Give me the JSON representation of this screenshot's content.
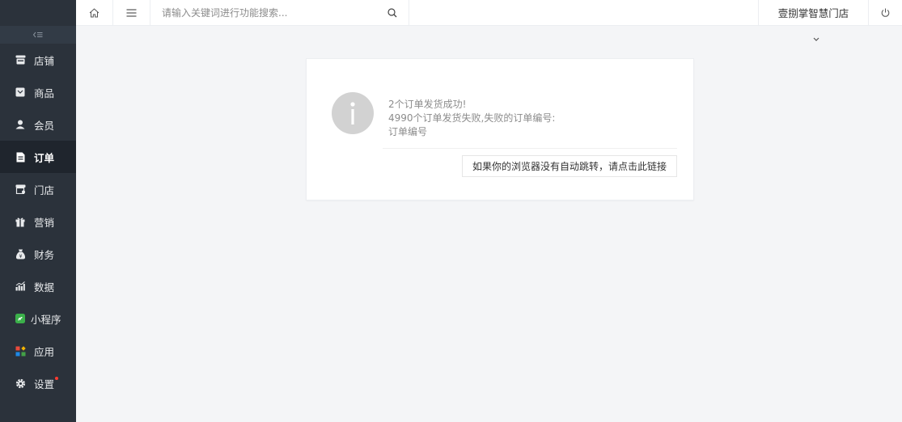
{
  "sidebar": {
    "items": [
      {
        "label": "店铺",
        "icon": "store-icon"
      },
      {
        "label": "商品",
        "icon": "goods-icon"
      },
      {
        "label": "会员",
        "icon": "member-icon"
      },
      {
        "label": "订单",
        "icon": "order-icon"
      },
      {
        "label": "门店",
        "icon": "shop-icon"
      },
      {
        "label": "营销",
        "icon": "gift-icon"
      },
      {
        "label": "财务",
        "icon": "finance-icon"
      },
      {
        "label": "数据",
        "icon": "chart-icon"
      },
      {
        "label": "小程序",
        "icon": "miniprogram-icon"
      },
      {
        "label": "应用",
        "icon": "apps-icon"
      },
      {
        "label": "设置",
        "icon": "gear-icon"
      }
    ],
    "active_index": 3
  },
  "topbar": {
    "search_placeholder": "请输入关键词进行功能搜索...",
    "store_name": "壹捌掌智慧门店"
  },
  "message": {
    "line1": "2个订单发货成功!",
    "line2": "4990个订单发货失败,失败的订单编号:",
    "line3": "订单编号",
    "link_text": "如果你的浏览器没有自动跳转，请点击此链接"
  },
  "colors": {
    "sidebar_bg": "#2b323b",
    "sidebar_active_bg": "#1f252d",
    "page_bg": "#f4f5f7",
    "info_icon_bg": "#d2d2d2",
    "badge_red": "#ff3b30"
  }
}
